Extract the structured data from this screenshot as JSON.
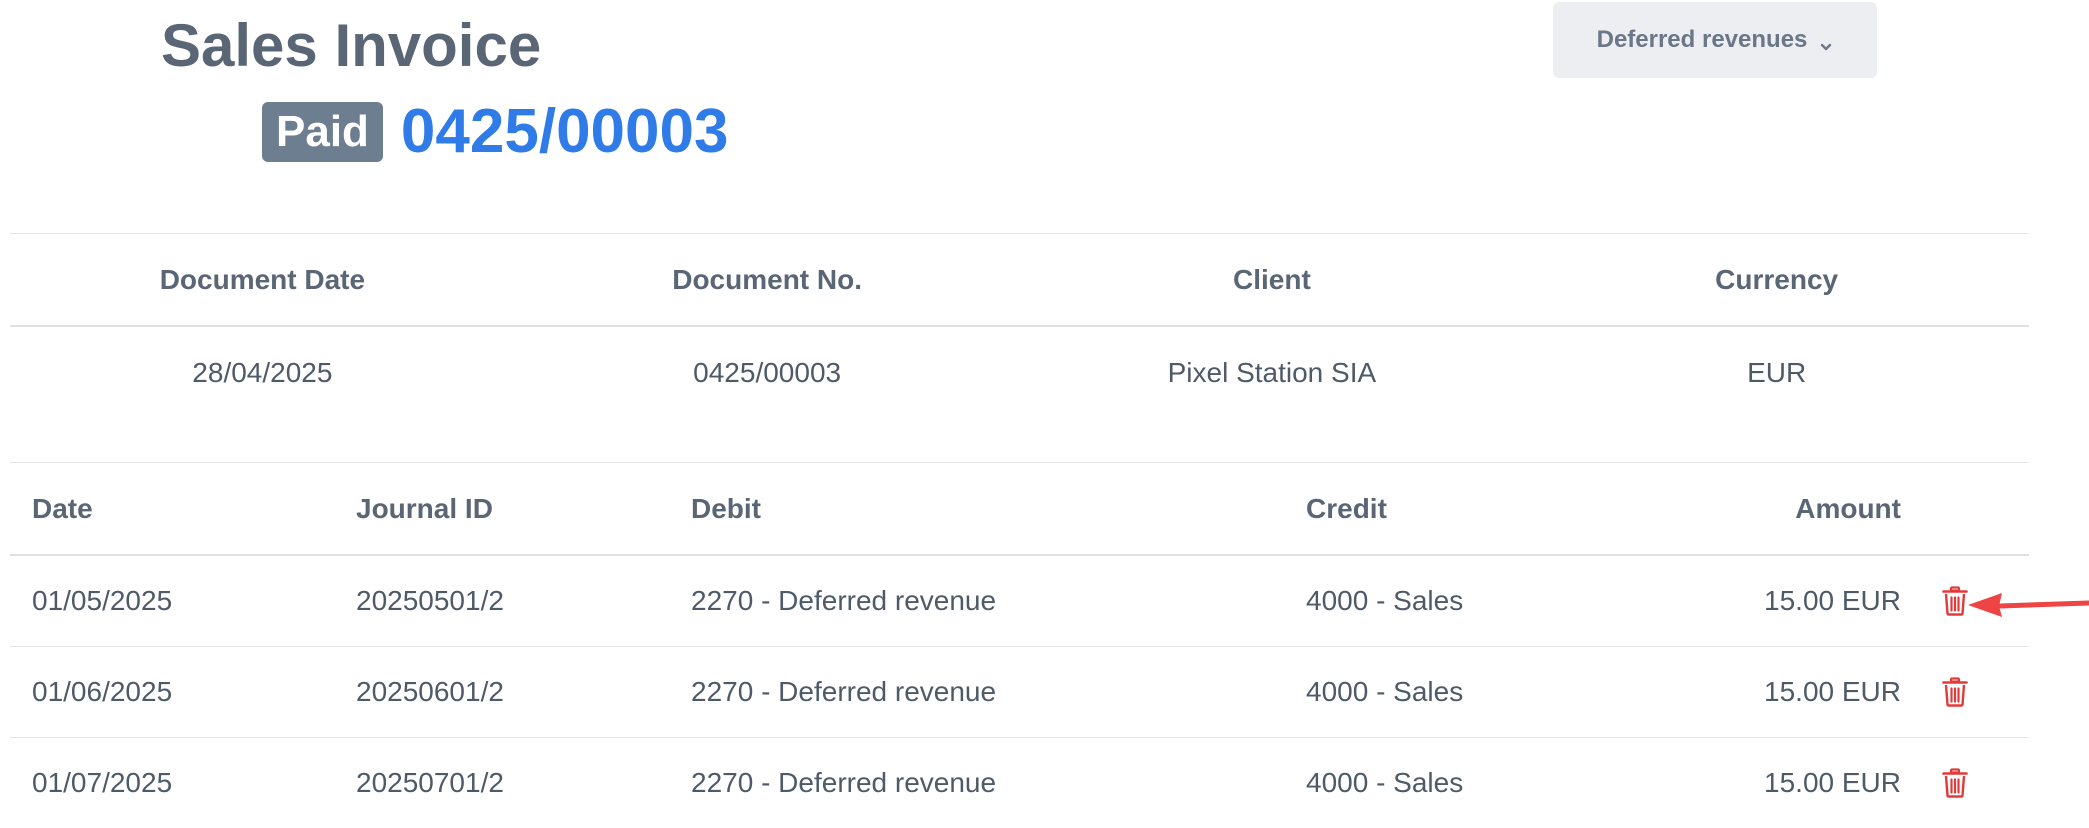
{
  "header": {
    "title": "Sales Invoice",
    "status": "Paid",
    "invoice_number": "0425/00003"
  },
  "dropdown": {
    "label": "Deferred revenues"
  },
  "summary": {
    "headers": [
      "Document Date",
      "Document No.",
      "Client",
      "Currency"
    ],
    "values": {
      "document_date": "28/04/2025",
      "document_no": "0425/00003",
      "client": "Pixel Station SIA",
      "currency": "EUR"
    }
  },
  "entries": {
    "headers": {
      "date": "Date",
      "journal_id": "Journal ID",
      "debit": "Debit",
      "credit": "Credit",
      "amount": "Amount"
    },
    "rows": [
      {
        "date": "01/05/2025",
        "journal_id": "20250501/2",
        "debit": "2270 - Deferred revenue",
        "credit": "4000 - Sales",
        "amount": "15.00 EUR"
      },
      {
        "date": "01/06/2025",
        "journal_id": "20250601/2",
        "debit": "2270 - Deferred revenue",
        "credit": "4000 - Sales",
        "amount": "15.00 EUR"
      },
      {
        "date": "01/07/2025",
        "journal_id": "20250701/2",
        "debit": "2270 - Deferred revenue",
        "credit": "4000 - Sales",
        "amount": "15.00 EUR"
      }
    ],
    "row_action_icon": "trash-icon"
  },
  "colors": {
    "link": "#2f7be8",
    "badge": "#6e7e91",
    "delete": "#e03b3b",
    "annotation_arrow": "#ef4444"
  }
}
